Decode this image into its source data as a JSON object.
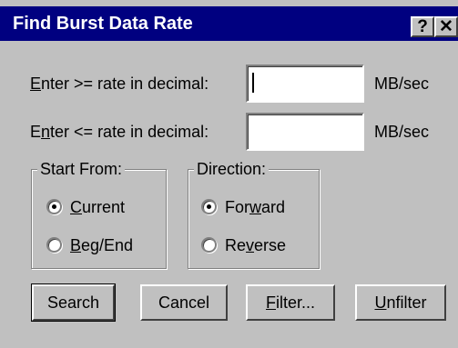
{
  "window": {
    "title": "Find Burst Data Rate",
    "help_glyph": "?",
    "close_glyph": "✕"
  },
  "fields": {
    "min_rate": {
      "label_mnemonic": "E",
      "label_rest": "nter >= rate in decimal:",
      "value": "",
      "unit": "MB/sec"
    },
    "max_rate": {
      "label_pre": "E",
      "label_mnemonic": "n",
      "label_rest": "ter <= rate in decimal:",
      "value": "",
      "unit": "MB/sec"
    }
  },
  "start_from": {
    "title": "Start From:",
    "options": [
      {
        "mnemonic": "C",
        "rest": "urrent",
        "selected": true
      },
      {
        "mnemonic": "B",
        "rest": "eg/End",
        "selected": false
      }
    ]
  },
  "direction": {
    "title": "Direction:",
    "options": [
      {
        "pre": "For",
        "mnemonic": "w",
        "rest": "ard",
        "selected": true
      },
      {
        "pre": "Re",
        "mnemonic": "v",
        "rest": "erse",
        "selected": false
      }
    ]
  },
  "buttons": {
    "search": "Search",
    "cancel": "Cancel",
    "filter": {
      "mnemonic": "F",
      "rest": "ilter..."
    },
    "unfilter": {
      "mnemonic": "U",
      "rest": "nfilter"
    }
  },
  "colors": {
    "titlebar": "#000080",
    "dialog_face": "#c0c0c0"
  },
  "icons": {
    "help": "question-mark-icon",
    "close": "close-icon",
    "radio_selected": "radio-selected-icon",
    "radio_unselected": "radio-unselected-icon"
  }
}
